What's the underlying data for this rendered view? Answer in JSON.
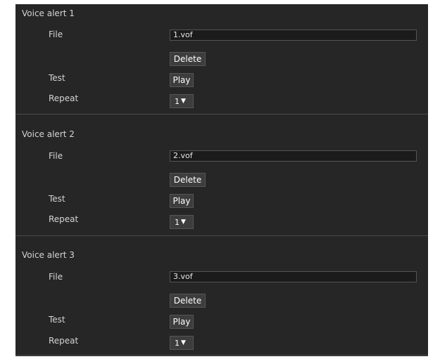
{
  "sections": [
    {
      "title": "Voice alert 1",
      "file_label": "File",
      "file_value": "1.vof",
      "delete_label": "Delete",
      "test_label": "Test",
      "play_label": "Play",
      "repeat_label": "Repeat",
      "repeat_value": "1",
      "repeat_icon": "triangle-down-icon"
    },
    {
      "title": "Voice alert 2",
      "file_label": "File",
      "file_value": "2.vof",
      "delete_label": "Delete",
      "test_label": "Test",
      "play_label": "Play",
      "repeat_label": "Repeat",
      "repeat_value": "1",
      "repeat_icon": "triangle-down-icon"
    },
    {
      "title": "Voice alert 3",
      "file_label": "File",
      "file_value": "3.vof",
      "delete_label": "Delete",
      "test_label": "Test",
      "play_label": "Play",
      "repeat_label": "Repeat",
      "repeat_value": "1",
      "repeat_icon": "triangle-down-icon"
    }
  ],
  "colors": {
    "panel_background": "#262626",
    "text": "#d4d4d4",
    "divider": "#4a4a4a",
    "field_background": "#1b1b1b",
    "button_background": "#3d3d3d"
  }
}
